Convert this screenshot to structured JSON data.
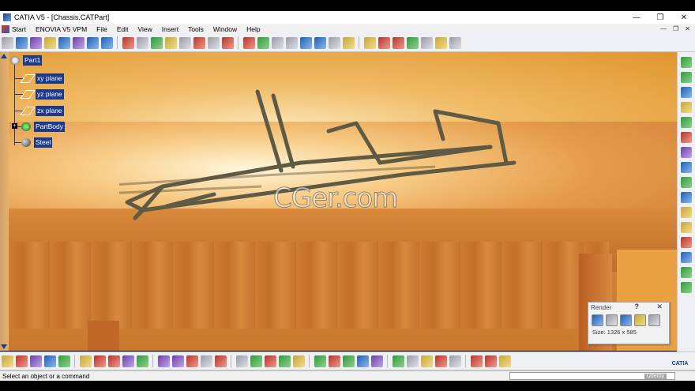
{
  "window": {
    "title": "CATIA V5 - [Chassis.CATPart]",
    "controls": [
      "—",
      "❐",
      "✕"
    ]
  },
  "menu": {
    "items": [
      "Start",
      "ENOVIA V5 VPM",
      "File",
      "Edit",
      "View",
      "Insert",
      "Tools",
      "Window",
      "Help"
    ],
    "doc_controls": [
      "—",
      "❐",
      "✕"
    ]
  },
  "tree": {
    "root": "Part1",
    "children": [
      "xy plane",
      "yz plane",
      "zx plane",
      "PartBody",
      "Steel"
    ]
  },
  "watermark": "CGer.com",
  "render_panel": {
    "title": "Render",
    "help": "?",
    "close": "✕",
    "size": "Size: 1326 x 585"
  },
  "status": {
    "message": "Select an object or a command"
  },
  "branding": {
    "udemy": "Udemy",
    "catia": "CATIA"
  },
  "icons": {
    "top_toolbar": [
      "move-icon",
      "compass-icon",
      "spec-icon",
      "sketch-icon",
      "snap-icon",
      "measure-icon",
      "analysis-icon",
      "catalog-icon",
      "parameter-icon",
      "formula-icon",
      "knowledge-icon",
      "swap-icon",
      "view-icon",
      "front-view-icon",
      "top-view-icon",
      "iso-view-icon",
      "shading-icon",
      "material-icon",
      "cube-icon",
      "pad-icon",
      "pocket-icon",
      "shaft-icon",
      "groove-icon",
      "hole-icon",
      "rib-icon",
      "slot-icon",
      "stiffener-icon",
      "loft-icon",
      "remove-icon",
      "grid-icon",
      "axis-icon"
    ],
    "bottom_toolbar": [
      "new-icon",
      "open-icon",
      "save-icon",
      "print-icon",
      "cut-icon",
      "copy-icon",
      "paste-icon",
      "undo-icon",
      "redo-icon",
      "whats-this-icon",
      "fx-icon",
      "comment-icon",
      "table-icon",
      "knowledge-icon",
      "fly-icon",
      "fit-all-icon",
      "pan-icon",
      "rotate-icon",
      "zoom-in-icon",
      "zoom-out-icon",
      "normal-view-icon",
      "iso-view-icon",
      "view-mode-icon",
      "hide-show-icon",
      "swap-visible-icon",
      "render-icon",
      "apply-material-icon",
      "update-icon",
      "measure-icon",
      "axis-system-icon",
      "scale-icon",
      "grid-icon",
      "catalog-icon"
    ],
    "right_toolbar": [
      "compass-icon",
      "select-icon",
      "sketch-icon",
      "layers-icon",
      "pad-icon",
      "pocket-icon",
      "fillet-icon",
      "chamfer-icon",
      "draft-icon",
      "shell-icon",
      "point-icon",
      "line-icon",
      "plane-icon",
      "boolean-icon",
      "union-icon",
      "trim-icon"
    ]
  }
}
